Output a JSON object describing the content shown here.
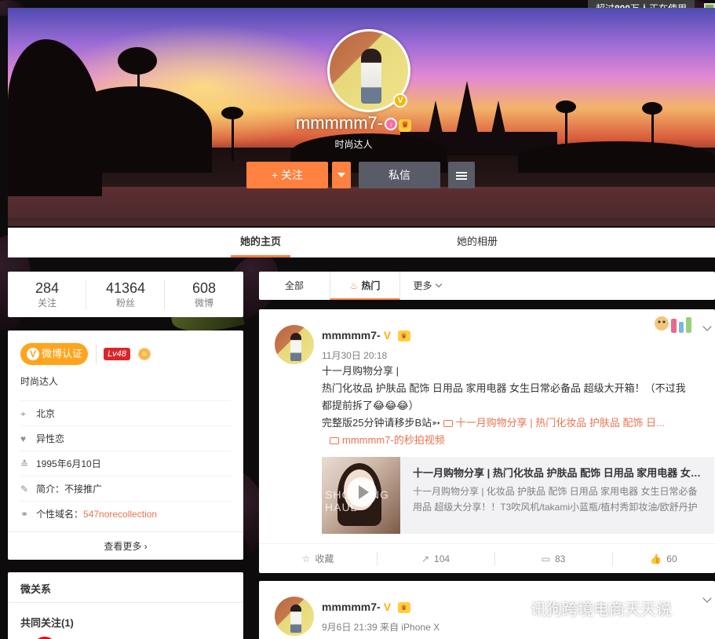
{
  "top_notice": {
    "prefix": "超过",
    "count": "800",
    "suffix": "万人正在使用"
  },
  "profile_header": {
    "name": "mmmmm7-",
    "description": "时尚达人",
    "follow_label": "关注",
    "message_label": "私信"
  },
  "main_tabs": [
    {
      "label": "她的主页",
      "active": true
    },
    {
      "label": "她的相册",
      "active": false
    }
  ],
  "stats": [
    {
      "value": "284",
      "label": "关注"
    },
    {
      "value": "41364",
      "label": "粉丝"
    },
    {
      "value": "608",
      "label": "微博"
    }
  ],
  "profile_card": {
    "verify_label": "微博认证",
    "level": "Lv48",
    "tagline": "时尚达人",
    "location": "北京",
    "relationship": "异性恋",
    "birthday": "1995年6月10日",
    "intro_label": "简介：",
    "intro_value": "不接推广",
    "domain_label": "个性域名：",
    "domain_value": "547norecollection",
    "see_more": "查看更多"
  },
  "relation_card": {
    "title": "微关系",
    "common_follow": "共同关注(1)"
  },
  "feed_tabs": {
    "all": "全部",
    "hot": "热门",
    "more": "更多"
  },
  "post1": {
    "author": "mmmmm7-",
    "time": "11月30日 20:18",
    "line1": "十一月购物分享 |",
    "line2": "热门化妆品 护肤品 配饰 日用品 家用电器 女生日常必备品 超级大开箱！（不过我",
    "line3": "都提前拆了😂😂😂）",
    "line4_text": "完整版25分钟请移步B站➳",
    "line4_link": "十一月购物分享 | 热门化妆品 护肤品 配饰 日...",
    "line5_link": "mmmmm7-的秒拍视频",
    "video_title": "十一月购物分享 | 热门化妆品 护肤品 配饰 日用品 家用电器 女生日常必备品",
    "video_desc": "十一月购物分享 | 化妆品 护肤品 配饰 日用品 家用电器 女生日常必备用品 超级大分享！！T3吹风机/takami小蓝瓶/植村秀卸妆油/欧舒丹护",
    "video_watermark": "SHOPPING HAUL",
    "actions": {
      "favorite": "收藏",
      "repost": "104",
      "comment": "83",
      "like": "60"
    }
  },
  "post2": {
    "author": "mmmmm7-",
    "time": "9月6日 21:39 来自 iPhone X"
  },
  "watermark": "讯狗跨境电商天天说",
  "colors": {
    "accent": "#ff8140",
    "link": "#eb7350",
    "verify": "#ffa41c",
    "level": "#d9262b"
  }
}
